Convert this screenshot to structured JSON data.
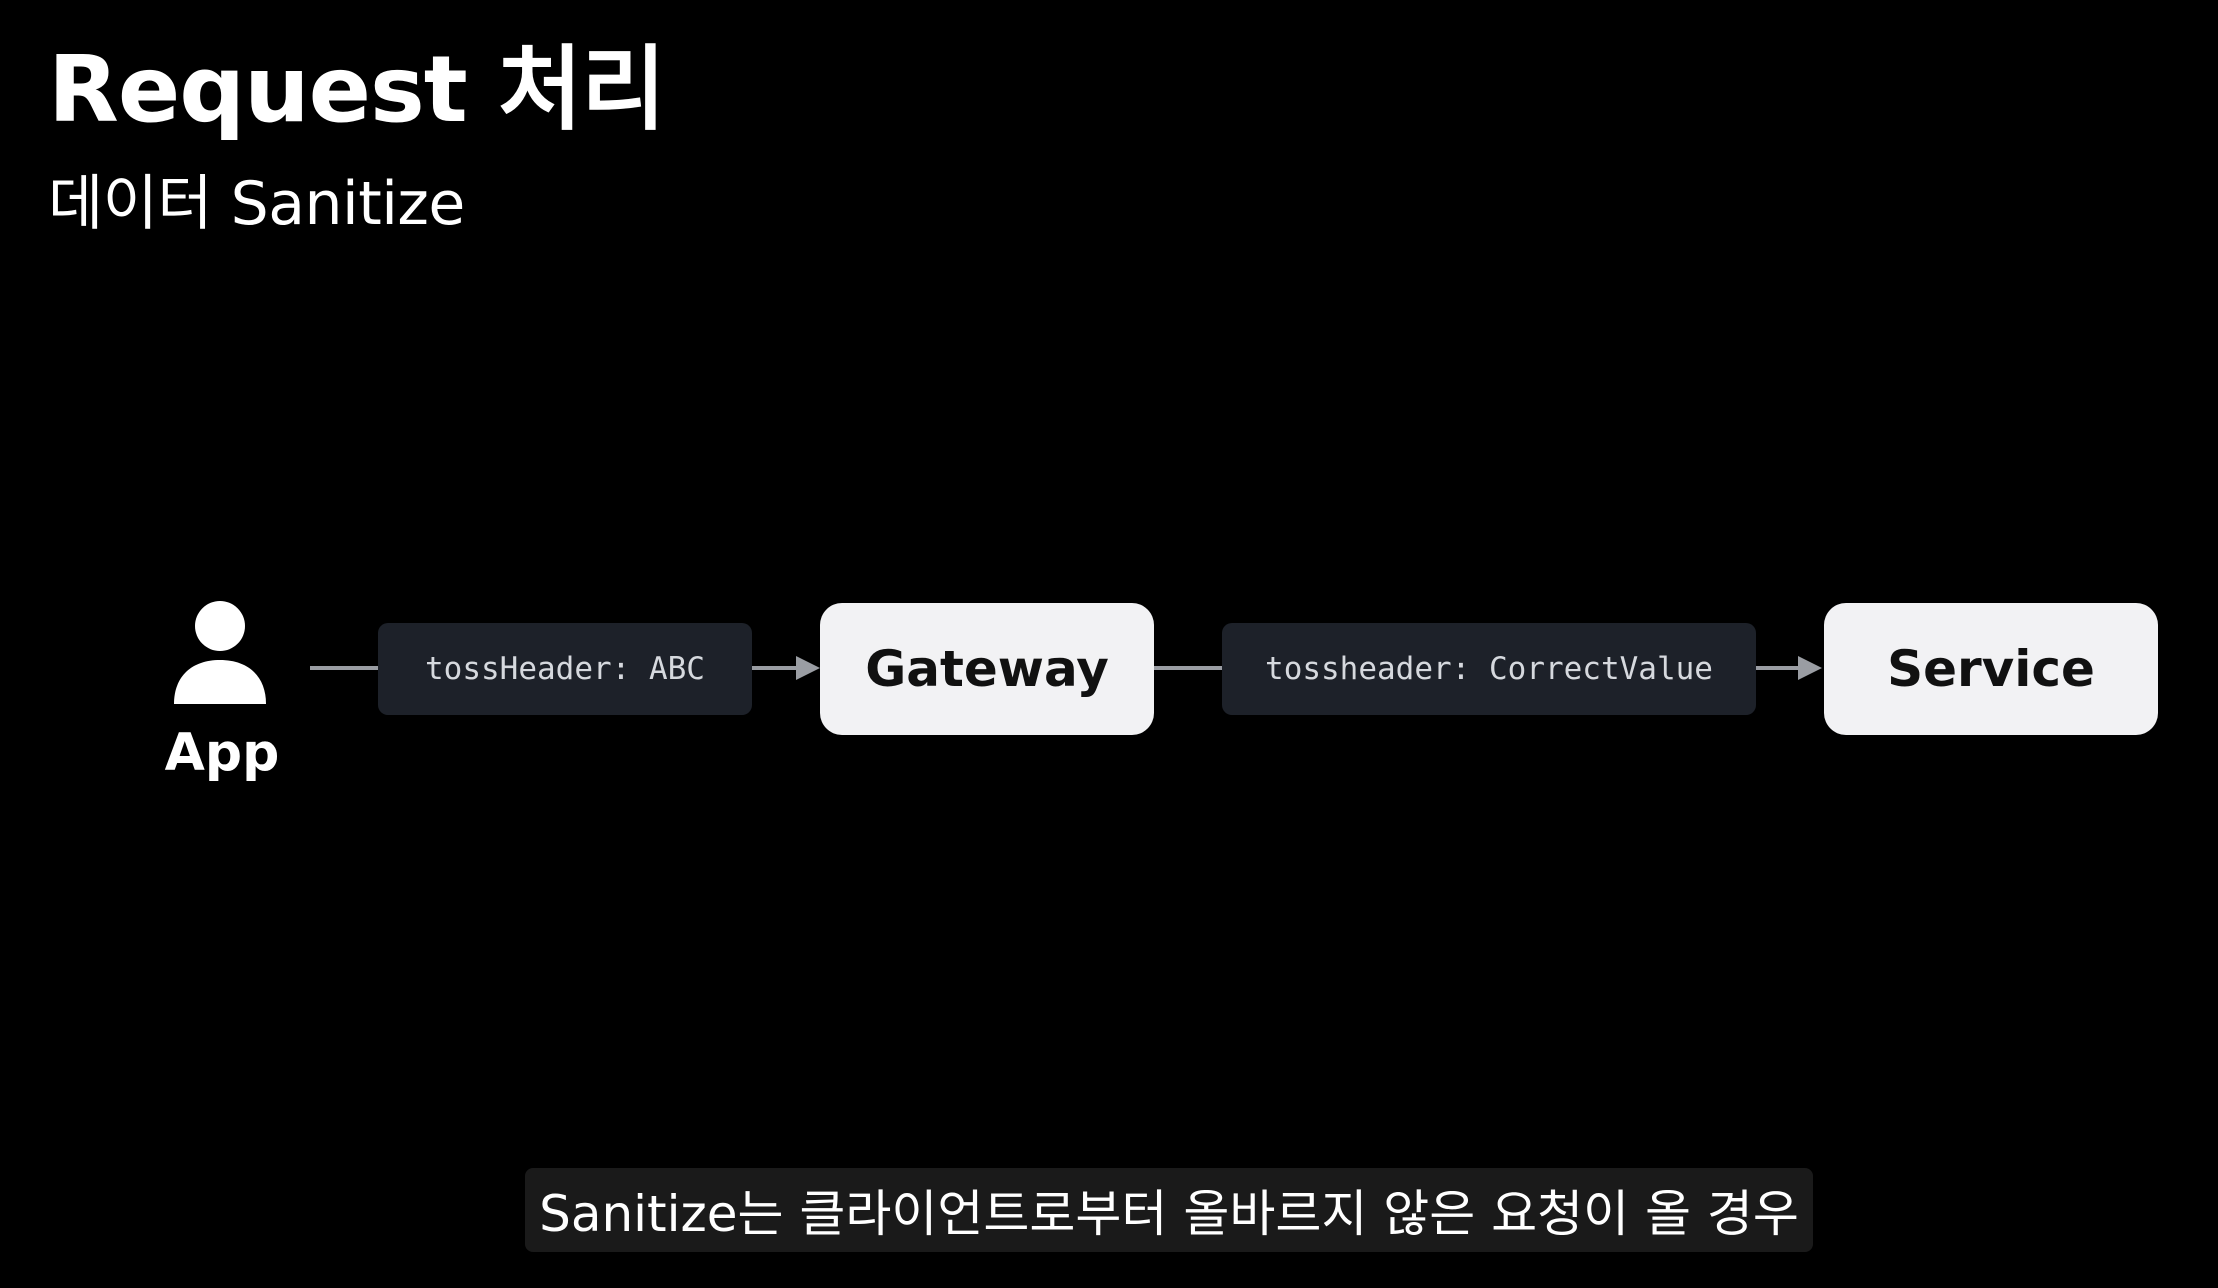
{
  "slide": {
    "title": "Request 처리",
    "subtitle": "데이터 Sanitize"
  },
  "diagram": {
    "actor": {
      "label": "App",
      "icon": "person-icon"
    },
    "chips": [
      {
        "text": "tossHeader: ABC"
      },
      {
        "text": "tossheader: CorrectValue"
      }
    ],
    "nodes": [
      {
        "label": "Gateway"
      },
      {
        "label": "Service"
      }
    ],
    "colors": {
      "background": "#000000",
      "node_fill": "#f2f2f4",
      "chip_fill": "#1d2129",
      "connector": "#9a9da3"
    }
  },
  "caption": {
    "text": "Sanitize는 클라이언트로부터 올바르지 않은 요청이 올 경우"
  }
}
